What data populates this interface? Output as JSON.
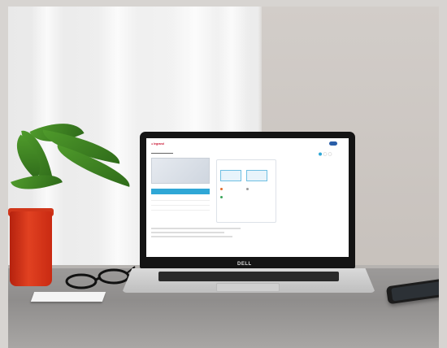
{
  "scene": {
    "description_colors": {
      "pot": "#e14121",
      "leaves": "#4f9a2b",
      "laptop_lid": "#141414",
      "laptop_base": "#d9d9d9",
      "table": "#9c9a99"
    }
  },
  "laptop": {
    "brand": "DELL"
  }
}
